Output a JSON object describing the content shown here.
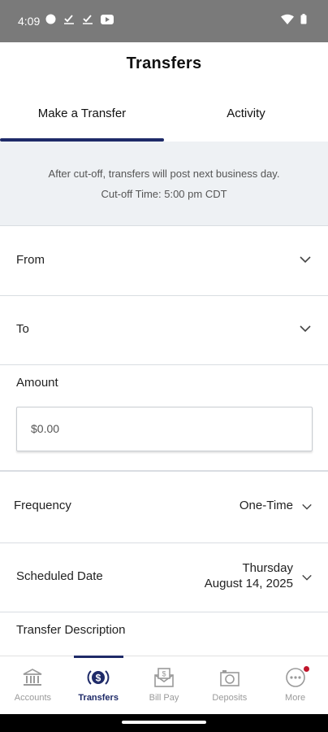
{
  "status_bar": {
    "time": "4:09"
  },
  "header": {
    "title": "Transfers"
  },
  "tabs": [
    {
      "label": "Make a Transfer",
      "active": true
    },
    {
      "label": "Activity",
      "active": false
    }
  ],
  "notice": {
    "line1": "After cut-off, transfers will post next business day.",
    "line2": "Cut-off Time: 5:00 pm CDT"
  },
  "form": {
    "from_label": "From",
    "to_label": "To",
    "amount_label": "Amount",
    "amount_value": "$0.00",
    "frequency_label": "Frequency",
    "frequency_value": "One-Time",
    "scheduled_date_label": "Scheduled Date",
    "scheduled_date_day": "Thursday",
    "scheduled_date_date": "August 14, 2025",
    "description_label": "Transfer Description"
  },
  "bottom_nav": [
    {
      "label": "Accounts",
      "icon": "bank-icon",
      "active": false
    },
    {
      "label": "Transfers",
      "icon": "transfer-dollar-icon",
      "active": true
    },
    {
      "label": "Bill Pay",
      "icon": "bill-envelope-icon",
      "active": false
    },
    {
      "label": "Deposits",
      "icon": "camera-icon",
      "active": false
    },
    {
      "label": "More",
      "icon": "more-dots-icon",
      "active": false,
      "badge": true
    }
  ],
  "colors": {
    "accent": "#1e2a68",
    "status_bar": "#7a7a7a",
    "notice_bg": "#eef1f4",
    "badge": "#c0152b"
  }
}
